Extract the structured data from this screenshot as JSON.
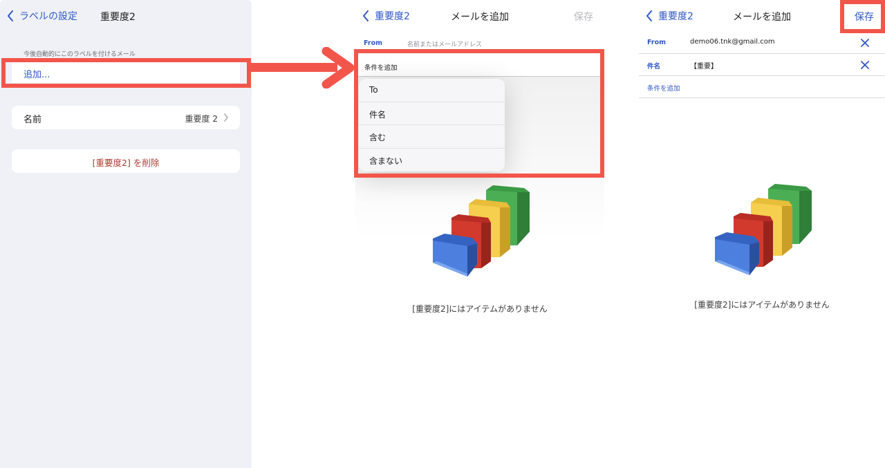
{
  "panel1": {
    "back_label": "ラベルの設定",
    "title": "重要度2",
    "section_hint": "今後自動的にこのラベルを付けるメール",
    "add_label": "追加...",
    "name_label": "名前",
    "name_value": "重要度 2",
    "delete_label": "[重要度2] を削除"
  },
  "panel2": {
    "back_label": "重要度2",
    "title": "メールを追加",
    "save_label": "保存",
    "from_label": "From",
    "from_placeholder": "名前またはメールアドレス",
    "condition_label": "条件を追加",
    "menu_options": [
      "To",
      "件名",
      "含む",
      "含まない"
    ],
    "empty_message": "[重要度2]にはアイテムがありません"
  },
  "panel3": {
    "back_label": "重要度2",
    "title": "メールを追加",
    "save_label": "保存",
    "fields": [
      {
        "key": "From",
        "value": "demo06.tnk@gmail.com"
      },
      {
        "key": "件名",
        "value": "【重要】"
      }
    ],
    "add_condition_label": "条件を追加",
    "empty_message": "[重要度2]にはアイテムがありません"
  },
  "colors": {
    "accent": "#2f57c4",
    "highlight": "#f2564b",
    "delete_text": "#b33a2e",
    "save_disabled": "#b8b8bd"
  },
  "icons": [
    "chevron-left-icon",
    "chevron-right-icon",
    "close-icon",
    "arrow-right-icon",
    "folders-illustration"
  ]
}
